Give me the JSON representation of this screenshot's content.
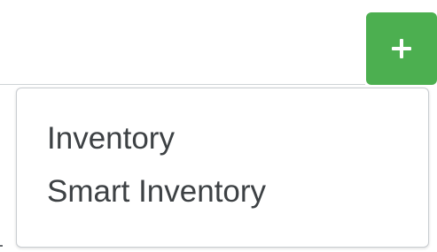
{
  "toolbar": {
    "add_button_icon": "plus-icon"
  },
  "dropdown": {
    "items": [
      {
        "label": "Inventory"
      },
      {
        "label": "Smart Inventory"
      }
    ]
  },
  "colors": {
    "accent": "#4caf50",
    "text": "#3d4144",
    "border": "#c9cdd1"
  }
}
